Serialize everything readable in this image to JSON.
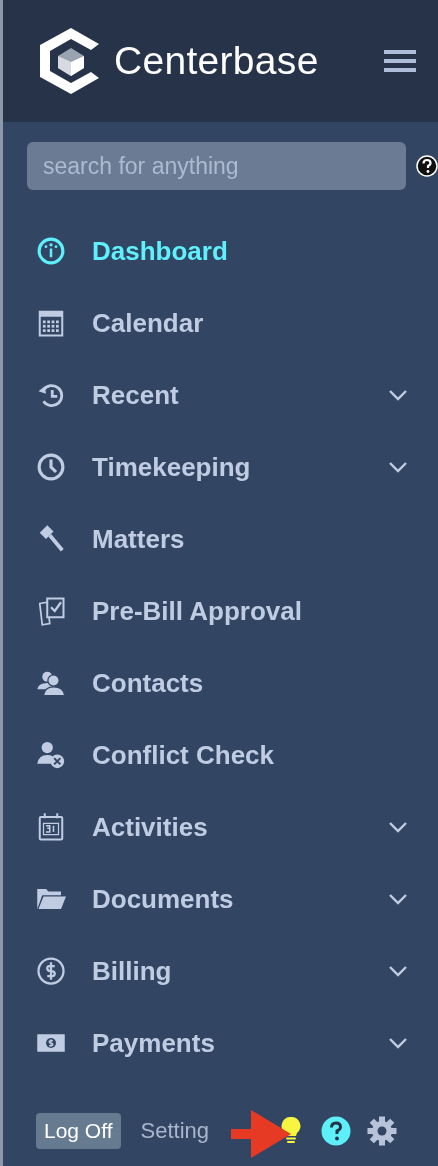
{
  "header": {
    "brand": "Centerbase"
  },
  "search": {
    "placeholder": "search for anything"
  },
  "nav": [
    {
      "label": "Dashboard",
      "selected": true,
      "kind": "link"
    },
    {
      "label": "Calendar",
      "selected": false,
      "kind": "link"
    },
    {
      "label": "Recent",
      "selected": false,
      "kind": "group"
    },
    {
      "label": "Timekeeping",
      "selected": false,
      "kind": "group"
    },
    {
      "label": "Matters",
      "selected": false,
      "kind": "link"
    },
    {
      "label": "Pre-Bill Approval",
      "selected": false,
      "kind": "link"
    },
    {
      "label": "Contacts",
      "selected": false,
      "kind": "link"
    },
    {
      "label": "Conflict Check",
      "selected": false,
      "kind": "link"
    },
    {
      "label": "Activities",
      "selected": false,
      "kind": "group"
    },
    {
      "label": "Documents",
      "selected": false,
      "kind": "group"
    },
    {
      "label": "Billing",
      "selected": false,
      "kind": "group"
    },
    {
      "label": "Payments",
      "selected": false,
      "kind": "group"
    }
  ],
  "footer": {
    "logoff": "Log Off",
    "settings": "Setting"
  }
}
